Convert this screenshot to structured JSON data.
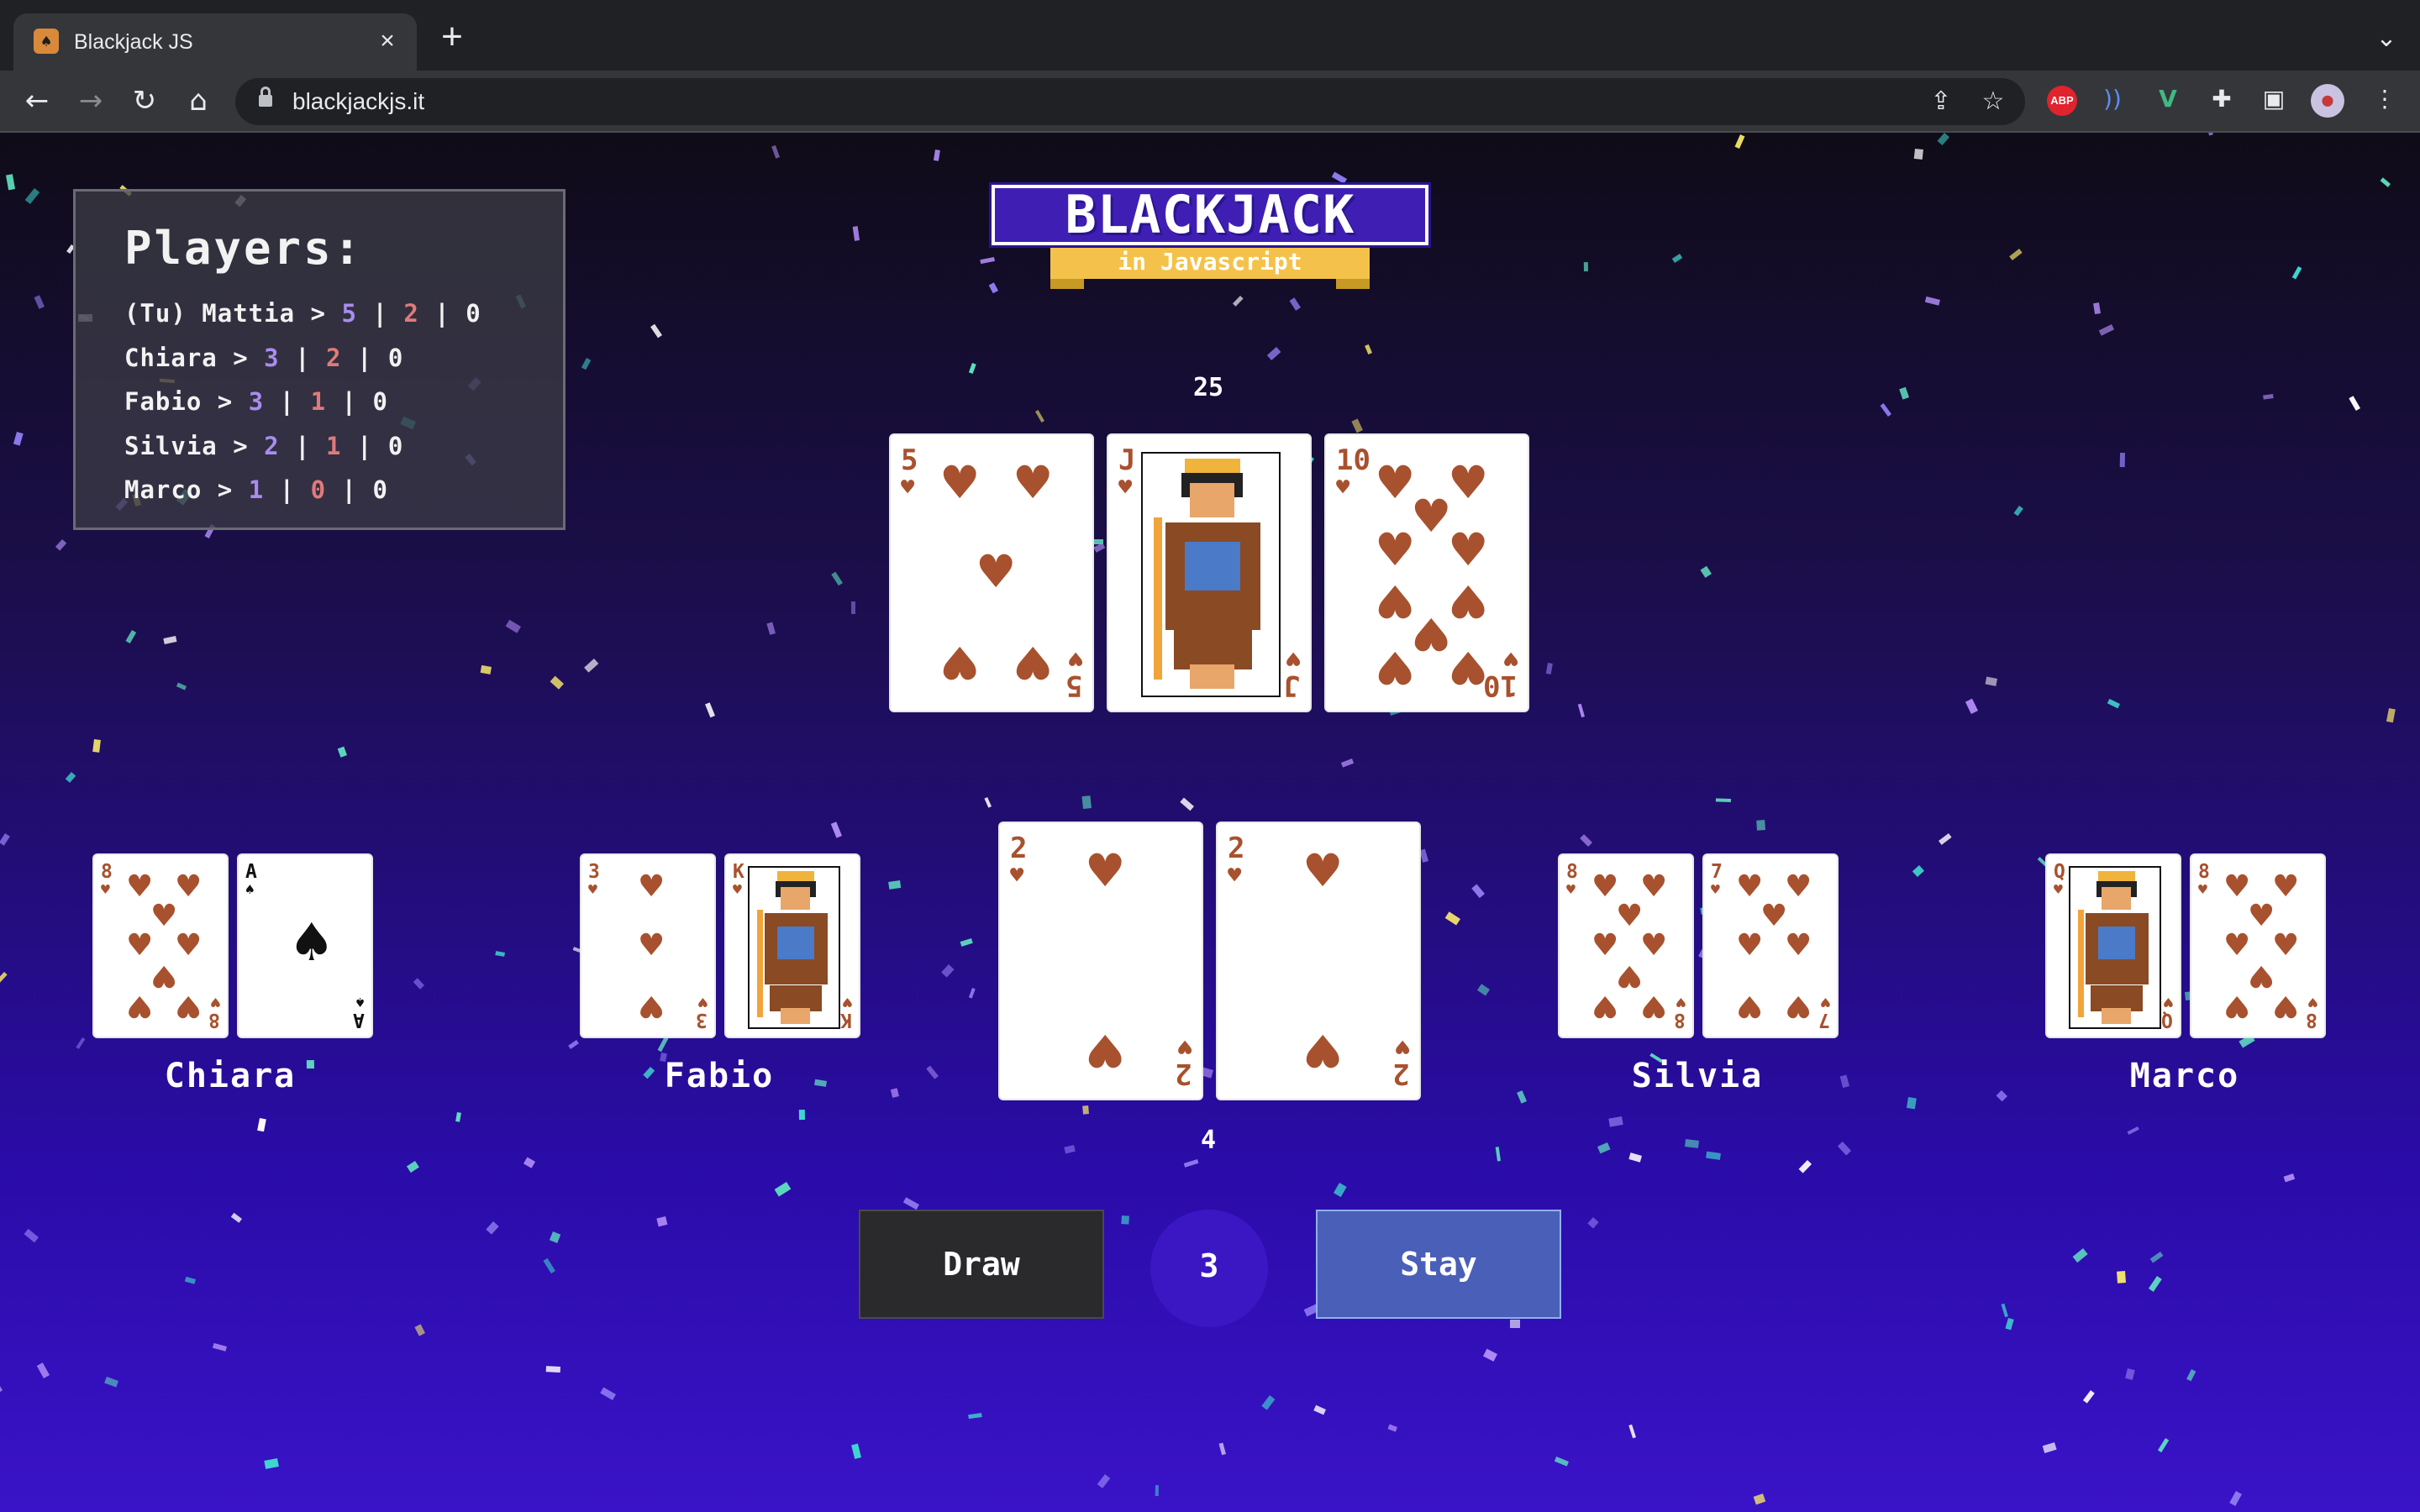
{
  "browser": {
    "tab_title": "Blackjack JS",
    "tab_close": "×",
    "new_tab": "+",
    "url": "blackjackjs.it",
    "extensions": [
      "abp-icon",
      "audio-icon",
      "vue-icon",
      "puzzle-icon",
      "sidepanel-icon"
    ],
    "abp_label": "ABP"
  },
  "players_panel": {
    "title": "Players:",
    "rows": [
      {
        "name": "(Tu) Mattia",
        "wins": "5",
        "losses": "2",
        "ties": "0"
      },
      {
        "name": "Chiara",
        "wins": "3",
        "losses": "2",
        "ties": "0"
      },
      {
        "name": "Fabio",
        "wins": "3",
        "losses": "1",
        "ties": "0"
      },
      {
        "name": "Silvia",
        "wins": "2",
        "losses": "1",
        "ties": "0"
      },
      {
        "name": "Marco",
        "wins": "1",
        "losses": "0",
        "ties": "0"
      }
    ]
  },
  "logo": {
    "title": "BLACKJACK",
    "subtitle": "in Javascript"
  },
  "dealer": {
    "score": "25",
    "cards": [
      {
        "rank": "5",
        "suit": "hearts"
      },
      {
        "rank": "J",
        "suit": "hearts"
      },
      {
        "rank": "10",
        "suit": "hearts"
      }
    ]
  },
  "player": {
    "score": "4",
    "cards": [
      {
        "rank": "2",
        "suit": "hearts"
      },
      {
        "rank": "2",
        "suit": "hearts"
      }
    ]
  },
  "opponents": [
    {
      "name": "Chiara",
      "cards": [
        {
          "rank": "8",
          "suit": "hearts"
        },
        {
          "rank": "A",
          "suit": "spades"
        }
      ]
    },
    {
      "name": "Fabio",
      "cards": [
        {
          "rank": "3",
          "suit": "hearts"
        },
        {
          "rank": "K",
          "suit": "hearts"
        }
      ]
    },
    {
      "name": "Silvia",
      "cards": [
        {
          "rank": "8",
          "suit": "hearts"
        },
        {
          "rank": "7",
          "suit": "hearts"
        }
      ]
    },
    {
      "name": "Marco",
      "cards": [
        {
          "rank": "Q",
          "suit": "hearts"
        },
        {
          "rank": "8",
          "suit": "hearts"
        }
      ]
    }
  ],
  "controls": {
    "draw_label": "Draw",
    "counter": "3",
    "stay_label": "Stay"
  },
  "colors": {
    "hearts": "#a8512e",
    "spades": "#111111",
    "stay": "#4a5fb8",
    "draw": "#2a2a2d"
  }
}
